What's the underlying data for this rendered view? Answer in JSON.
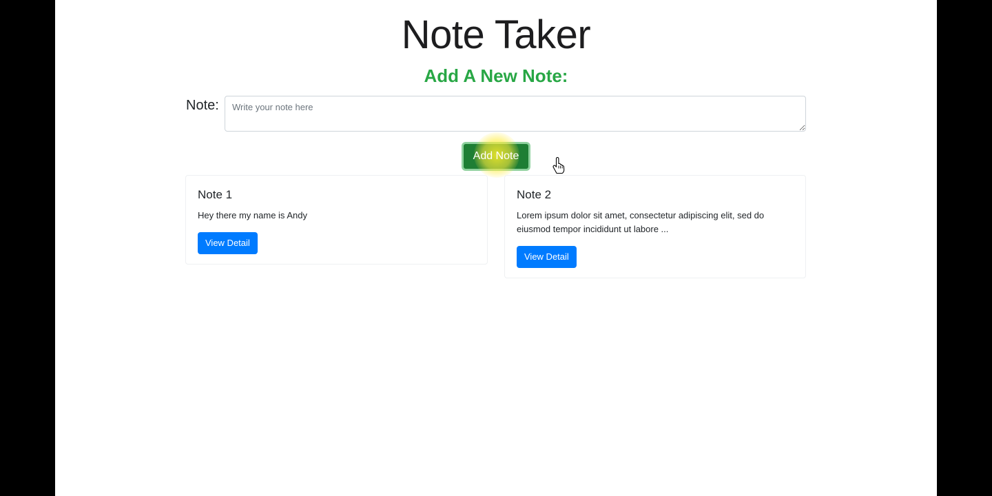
{
  "header": {
    "title": "Note Taker",
    "subtitle": "Add A New Note:"
  },
  "form": {
    "note_label": "Note:",
    "note_placeholder": "Write your note here",
    "note_value": "",
    "submit_label": "Add Note"
  },
  "notes": [
    {
      "title": "Note 1",
      "body": "Hey there my name is Andy",
      "action_label": "View Detail"
    },
    {
      "title": "Note 2",
      "body": "Lorem ipsum dolor sit amet, consectetur adipiscing elit, sed do eiusmod tempor incididunt ut labore ...",
      "action_label": "View Detail"
    }
  ],
  "colors": {
    "subtitle": "#28a745",
    "add_button": "#1e7e34",
    "view_button": "#007bff",
    "highlight": "#ffee33"
  },
  "icons": {
    "cursor": "hand-pointer-icon"
  }
}
